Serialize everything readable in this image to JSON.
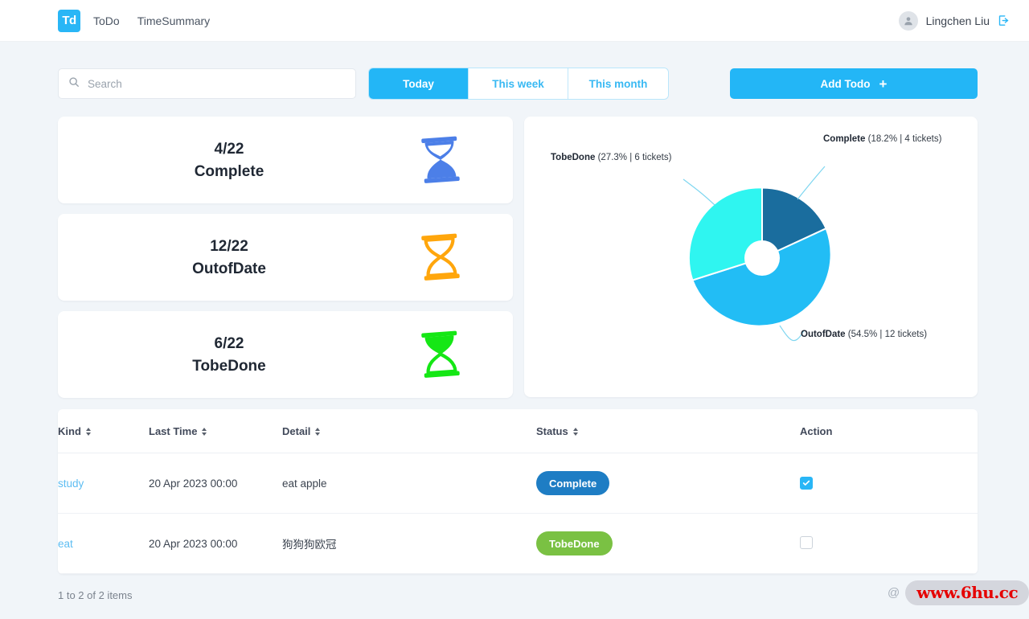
{
  "navbar": {
    "logo_text": "Td",
    "links": [
      {
        "label": "ToDo"
      },
      {
        "label": "TimeSummary"
      }
    ],
    "user_name": "Lingchen Liu",
    "avatar_icon": "user-icon",
    "logout_icon": "logout-icon"
  },
  "toolbar": {
    "search_placeholder": "Search",
    "search_value": "",
    "search_icon": "search-icon",
    "range_tabs": [
      {
        "label": "Today",
        "active": true
      },
      {
        "label": "This week",
        "active": false
      },
      {
        "label": "This month",
        "active": false
      }
    ],
    "add_button": {
      "label": "Add Todo",
      "plus": "+"
    }
  },
  "stats": [
    {
      "count": "4/22",
      "label": "Complete",
      "icon": "hourglass-icon",
      "color": "#4c7fe8"
    },
    {
      "count": "12/22",
      "label": "OutofDate",
      "icon": "hourglass-icon",
      "color": "#ffa60c"
    },
    {
      "count": "6/22",
      "label": "TobeDone",
      "icon": "hourglass-icon",
      "color": "#15e715"
    }
  ],
  "chart_data": {
    "type": "pie",
    "title": "",
    "donut": true,
    "legend_position": "callout-labels",
    "categories": [
      "Complete",
      "OutofDate",
      "TobeDone"
    ],
    "values": [
      4,
      12,
      6
    ],
    "percents": [
      18.2,
      54.5,
      27.3
    ],
    "colors": [
      "#1a6d9e",
      "#22bdf5",
      "#2ff5f0"
    ],
    "labels": [
      {
        "name": "Complete",
        "detail": "(18.2% | 4 tickets)"
      },
      {
        "name": "OutofDate",
        "detail": "(54.5% | 12 tickets)"
      },
      {
        "name": "TobeDone",
        "detail": "(27.3% | 6 tickets)"
      }
    ],
    "total_tickets": 22,
    "unit": "tickets"
  },
  "table": {
    "headers": [
      {
        "label": "Kind",
        "sortable": true
      },
      {
        "label": "Last Time",
        "sortable": true
      },
      {
        "label": "Detail",
        "sortable": true
      },
      {
        "label": "Status",
        "sortable": true
      },
      {
        "label": "Action",
        "sortable": false
      }
    ],
    "rows": [
      {
        "kind": "study",
        "last_time": "20 Apr 2023 00:00",
        "detail": "eat apple",
        "status": "Complete",
        "status_color": "blue",
        "checked": true
      },
      {
        "kind": "eat",
        "last_time": "20 Apr 2023 00:00",
        "detail": "狗狗狗欧冠",
        "status": "TobeDone",
        "status_color": "green",
        "checked": false
      }
    ],
    "footer_count": "1 to 2 of 2 items"
  },
  "watermark": {
    "at": "@",
    "text": "www.6hu.cc"
  }
}
